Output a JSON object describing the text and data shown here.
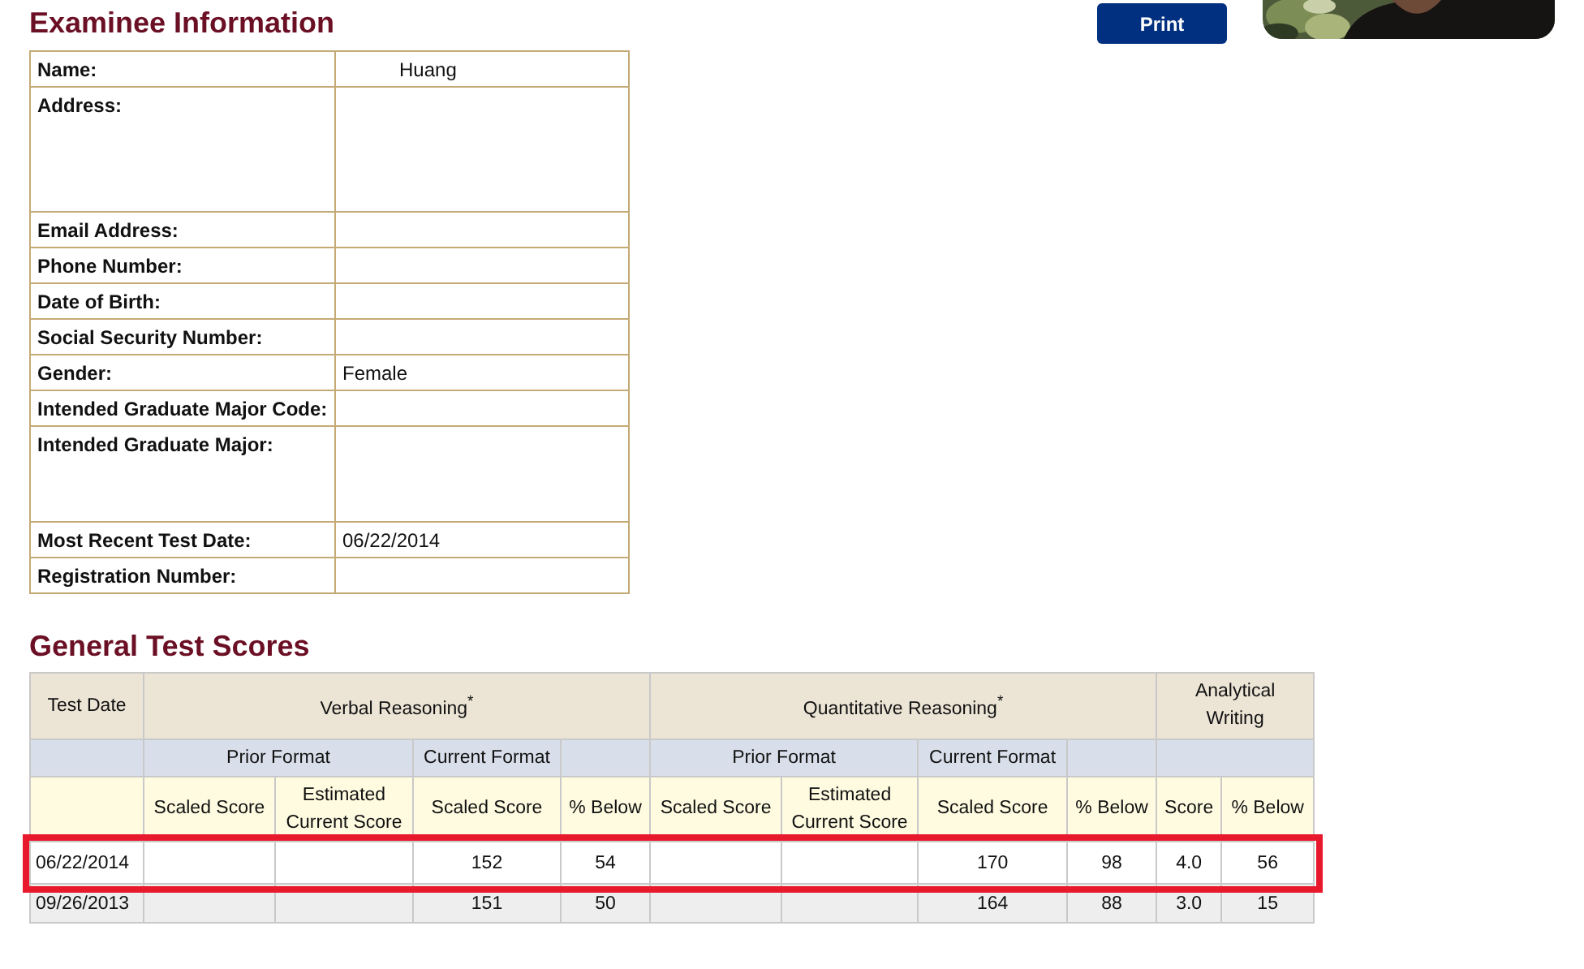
{
  "examinee": {
    "title": "Examinee Information",
    "print_button": "Print",
    "fields": [
      {
        "label": "Name:",
        "value": "Huang",
        "kind": "indented"
      },
      {
        "label": "Address:",
        "kind": "tall"
      },
      {
        "label": "Email Address:"
      },
      {
        "label": "Phone Number:"
      },
      {
        "label": "Date of Birth:"
      },
      {
        "label": "Social Security Number:"
      },
      {
        "label": "Gender:",
        "value": "Female"
      },
      {
        "label": "Intended Graduate Major Code:"
      },
      {
        "label": "Intended Graduate Major:",
        "kind": "medium"
      },
      {
        "label": "Most Recent Test Date:",
        "value": "06/22/2014"
      },
      {
        "label": "Registration Number:"
      }
    ]
  },
  "scores": {
    "title": "General Test Scores",
    "header_top": [
      "Test Date",
      "Verbal Reasoning$^{*}$",
      "Quantitative Reasoning$^{*}$",
      "Analytical Writing"
    ],
    "header_middle": [
      "Prior Format",
      "Current Format",
      "Prior Format",
      "Current Format"
    ],
    "header_bottom": [
      "Scaled Score",
      "Estimated Current Score",
      "Scaled Score",
      "% Below",
      "Scaled Score",
      "Estimated Current Score",
      "Scaled Score",
      "% Below",
      "Score",
      "% Below"
    ],
    "rows": [
      {
        "highlighted": true,
        "date": "06/22/2014",
        "verbal_scaled": "152",
        "verbal_below": "54",
        "quant_scaled": "170",
        "quant_below": "98",
        "writing_score": "4.0",
        "writing_below": "56"
      },
      {
        "highlighted": false,
        "date": "09/26/2013",
        "verbal_scaled": "151",
        "verbal_below": "50",
        "quant_scaled": "164",
        "quant_below": "88",
        "writing_score": "3.0",
        "writing_below": "15"
      }
    ]
  }
}
